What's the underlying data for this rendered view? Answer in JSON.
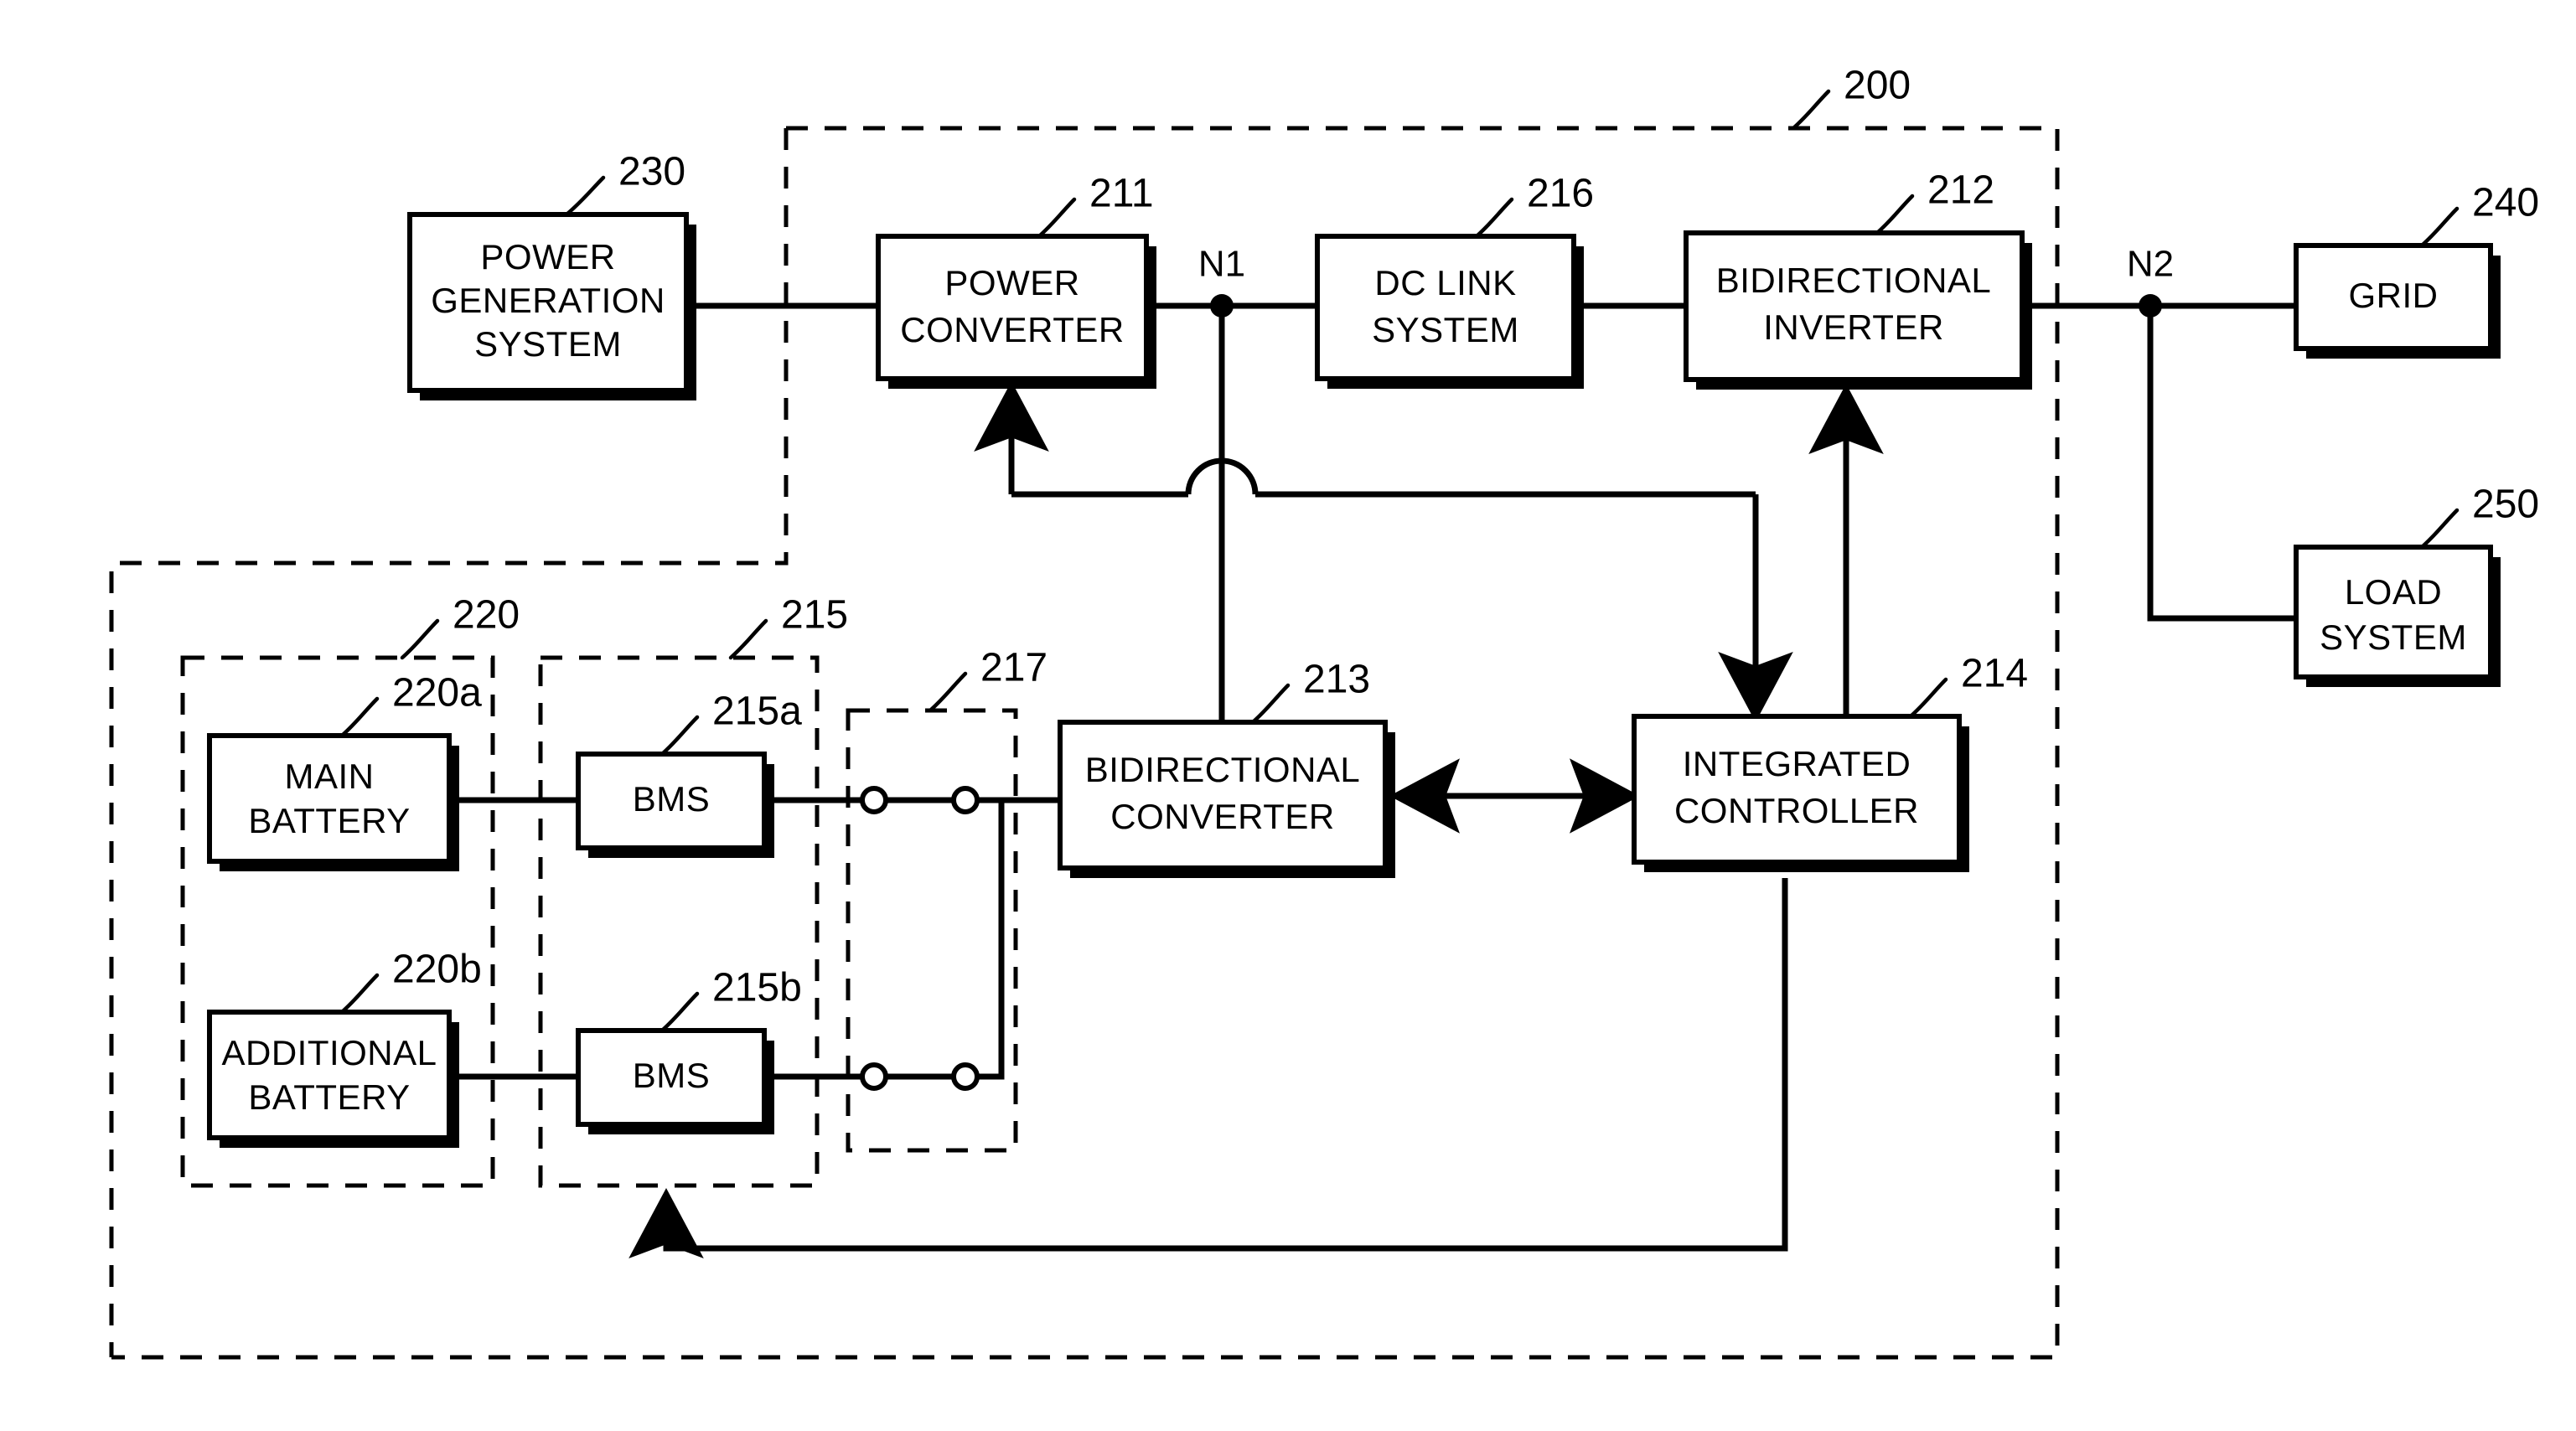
{
  "figure": {
    "kind": "patent-block-diagram",
    "ink_color": "#000000",
    "background_color": "#ffffff"
  },
  "blocks": {
    "power_generation_system": {
      "line1": "POWER",
      "line2": "GENERATION",
      "line3": "SYSTEM",
      "ref": "230"
    },
    "power_converter": {
      "line1": "POWER",
      "line2": "CONVERTER",
      "ref": "211"
    },
    "dc_link_system": {
      "line1": "DC LINK",
      "line2": "SYSTEM",
      "ref": "216"
    },
    "bidirectional_inverter": {
      "line1": "BIDIRECTIONAL",
      "line2": "INVERTER",
      "ref": "212"
    },
    "grid": {
      "line1": "GRID",
      "ref": "240"
    },
    "load_system": {
      "line1": "LOAD",
      "line2": "SYSTEM",
      "ref": "250"
    },
    "main_battery": {
      "line1": "MAIN",
      "line2": "BATTERY",
      "ref": "220a"
    },
    "additional_battery": {
      "line1": "ADDITIONAL",
      "line2": "BATTERY",
      "ref": "220b"
    },
    "bms_main": {
      "line1": "BMS",
      "ref": "215a"
    },
    "bms_additional": {
      "line1": "BMS",
      "ref": "215b"
    },
    "bidirectional_converter": {
      "line1": "BIDIRECTIONAL",
      "line2": "CONVERTER",
      "ref": "213"
    },
    "integrated_controller": {
      "line1": "INTEGRATED",
      "line2": "CONTROLLER",
      "ref": "214"
    }
  },
  "groups": {
    "power_conversion_system": {
      "ref": "200"
    },
    "battery_group": {
      "ref": "220"
    },
    "bms_group": {
      "ref": "215"
    },
    "switch_group": {
      "ref": "217"
    },
    "energy_storage_system": {
      "ref": ""
    }
  },
  "nodes": {
    "n1": {
      "label": "N1"
    },
    "n2": {
      "label": "N2"
    }
  }
}
